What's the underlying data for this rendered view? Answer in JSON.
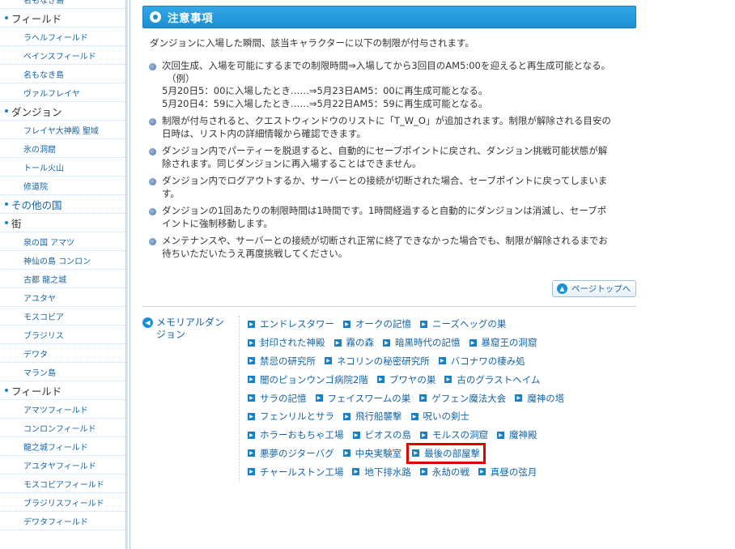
{
  "sidebar": {
    "items": [
      {
        "label": "名もなき島",
        "kind": "sub"
      },
      {
        "label": "フィールド",
        "kind": "head"
      },
      {
        "label": "ラヘルフィールド",
        "kind": "sub"
      },
      {
        "label": "ベインスフィールド",
        "kind": "sub"
      },
      {
        "label": "名もなき島",
        "kind": "sub"
      },
      {
        "label": "ヴァルフレイヤ",
        "kind": "sub"
      },
      {
        "label": "ダンジョン",
        "kind": "head"
      },
      {
        "label": "フレイヤ大神殿 聖域",
        "kind": "sub"
      },
      {
        "label": "氷の洞窟",
        "kind": "sub"
      },
      {
        "label": "トール火山",
        "kind": "sub"
      },
      {
        "label": "修道院",
        "kind": "sub"
      },
      {
        "label": "その他の国",
        "kind": "head-blue"
      },
      {
        "label": "街",
        "kind": "head"
      },
      {
        "label": "泉の国 アマツ",
        "kind": "sub"
      },
      {
        "label": "神仙の島 コンロン",
        "kind": "sub"
      },
      {
        "label": "古都 龍之城",
        "kind": "sub"
      },
      {
        "label": "アユタヤ",
        "kind": "sub"
      },
      {
        "label": "モスコビア",
        "kind": "sub"
      },
      {
        "label": "ブラジリス",
        "kind": "sub"
      },
      {
        "label": "デワタ",
        "kind": "sub"
      },
      {
        "label": "マラン島",
        "kind": "sub"
      },
      {
        "label": "フィールド",
        "kind": "head"
      },
      {
        "label": "アマツフィールド",
        "kind": "sub"
      },
      {
        "label": "コンロンフィールド",
        "kind": "sub"
      },
      {
        "label": "龍之城フィールド",
        "kind": "sub"
      },
      {
        "label": "アユタヤフィールド",
        "kind": "sub"
      },
      {
        "label": "モスコビアフィールド",
        "kind": "sub"
      },
      {
        "label": "ブラジリスフィールド",
        "kind": "sub"
      },
      {
        "label": "デワタフィールド",
        "kind": "sub"
      }
    ]
  },
  "section": {
    "title": "注意事項",
    "intro": "ダンジョンに入場した瞬間、該当キャラクターに以下の制限が付与されます。"
  },
  "notes": [
    {
      "lines": [
        "次回生成、入場を可能にするまでの制限時間⇒入場してから3回目のAM5:00を迎えると再生成可能となる。",
        "（例）",
        "5月20日5：00に入場したとき……⇒5月23日AM5：00に再生成可能となる。",
        "5月20日4：59に入場したとき……⇒5月22日AM5：59に再生成可能となる。"
      ]
    },
    {
      "lines": [
        "制限が付与されると、クエストウィンドウのリストに「T_W_O」が追加されます。制限が解除される目安の",
        "日時は、リスト内の詳細情報から確認できます。"
      ]
    },
    {
      "lines": [
        "ダンジョン内でパーティーを脱退すると、自動的にセーブポイントに戻され、ダンジョン挑戦可能状態が解",
        "除されます。同じダンジョンに再入場することはできません。"
      ]
    },
    {
      "lines": [
        "ダンジョン内でログアウトするか、サーバーとの接続が切断された場合、セーブポイントに戻ってしまいま",
        "す。"
      ]
    },
    {
      "lines": [
        "ダンジョンの1回あたりの制限時間は1時間です。1時間経過すると自動的にダンジョンは消滅し、セーブポ",
        "イントに強制移動します。"
      ]
    },
    {
      "lines": [
        "メンテナンスや、サーバーとの接続が切断され正常に終了できなかった場合でも、制限が解除されるまでお",
        "待ちいただいたうえ再度挑戦してください。"
      ]
    }
  ],
  "pagetop": {
    "label": "ページトップへ"
  },
  "memorial": {
    "label": "メモリアルダンジョン"
  },
  "links": [
    [
      "エンドレスタワー",
      "オークの記憶",
      "ニーズヘッグの巣"
    ],
    [
      "封印された神殿",
      "霧の森",
      "暗黒時代の記憶",
      "暴窟王の洞窟"
    ],
    [
      "禁忌の研究所",
      "ネコリンの秘密研究所",
      "バコナワの棲み処"
    ],
    [
      "闇のピョンウンゴ病院2階",
      "ブワヤの巣",
      "古のグラストヘイム"
    ],
    [
      "サラの記憶",
      "フェイスワームの巣",
      "ゲフェン魔法大会",
      "魔神の塔"
    ],
    [
      "フェンリルとサラ",
      "飛行船襲撃",
      "呪いの剣士"
    ],
    [
      "ホラーおもちゃ工場",
      "ビオスの島",
      "モルスの洞窟",
      "魔神殿"
    ],
    [
      "悪夢のジターバグ",
      "中央実験室",
      "最後の部屋撃"
    ],
    [
      "チャールストン工場",
      "地下排水路",
      "永劫の戦",
      "真昼の弦月"
    ]
  ],
  "highlight": {
    "row": 7,
    "col": 2,
    "color": "#e00000"
  }
}
